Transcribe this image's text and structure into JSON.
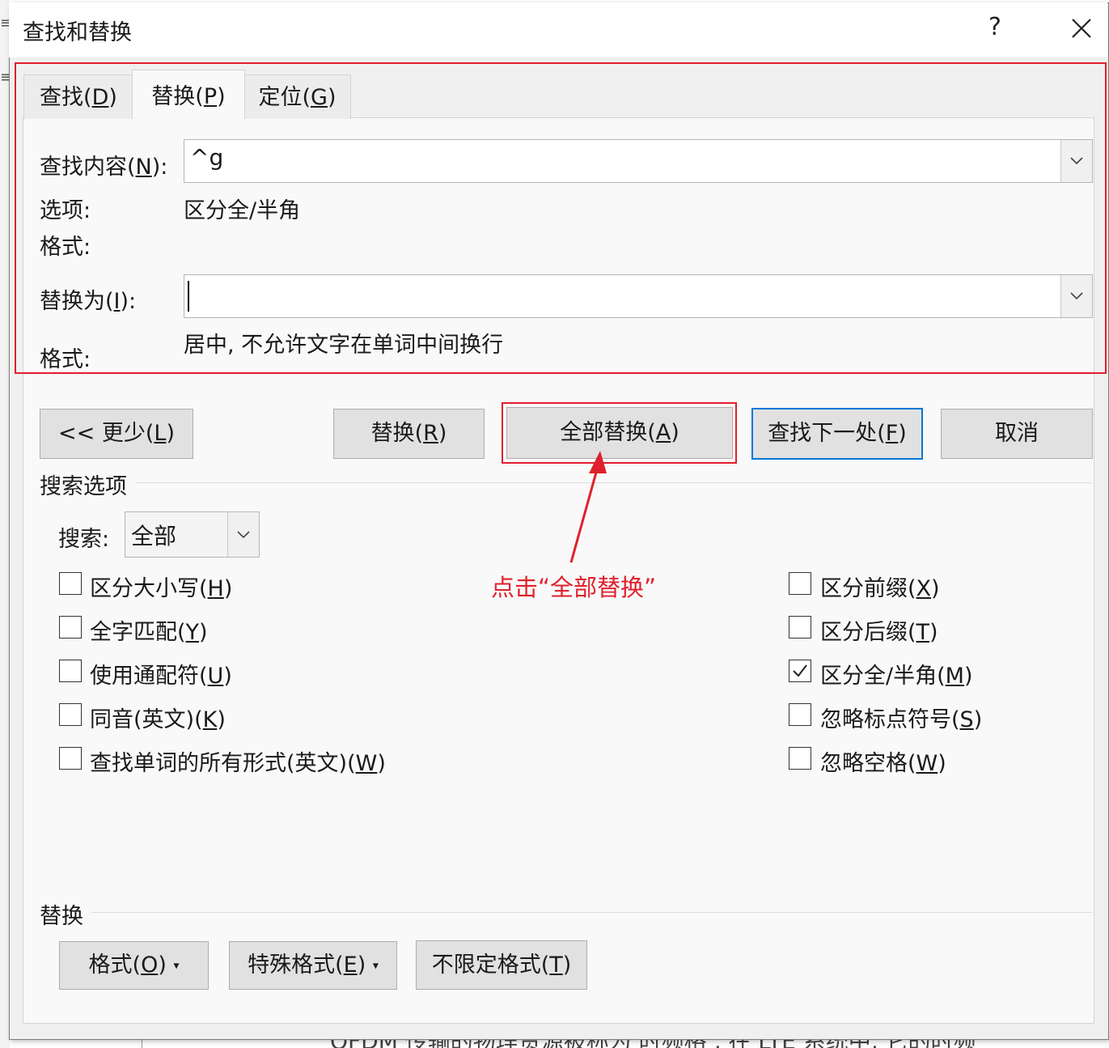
{
  "dialog": {
    "title": "查找和替换",
    "help": "?",
    "tabs": [
      {
        "label": "查找",
        "key": "D"
      },
      {
        "label": "替换",
        "key": "P"
      },
      {
        "label": "定位",
        "key": "G"
      }
    ],
    "find": {
      "label": "查找内容",
      "key": "N",
      "value": "^g"
    },
    "options_label": "选项:",
    "options_value": "区分全/半角",
    "format_label": "格式:",
    "replace": {
      "label": "替换为",
      "key": "I",
      "value": ""
    },
    "replace_format_label": "格式:",
    "replace_format_value": "居中, 不允许文字在单词中间换行",
    "buttons": {
      "less": {
        "prefix": "<< 更少",
        "key": "L"
      },
      "replace": {
        "prefix": "替换",
        "key": "R"
      },
      "replace_all": {
        "prefix": "全部替换",
        "key": "A"
      },
      "find_next": {
        "prefix": "查找下一处",
        "key": "F"
      },
      "cancel": "取消"
    },
    "search_options": {
      "title": "搜索选项",
      "search_label": "搜索:",
      "search_value": "全部",
      "left_checks": [
        {
          "label": "区分大小写",
          "key": "H",
          "checked": false
        },
        {
          "label": "全字匹配",
          "key": "Y",
          "checked": false
        },
        {
          "label": "使用通配符",
          "key": "U",
          "checked": false
        },
        {
          "label": "同音(英文)",
          "key": "K",
          "checked": false
        },
        {
          "label": "查找单词的所有形式(英文)",
          "key": "W",
          "checked": false
        }
      ],
      "right_checks": [
        {
          "label": "区分前缀",
          "key": "X",
          "checked": false
        },
        {
          "label": "区分后缀",
          "key": "T",
          "checked": false
        },
        {
          "label": "区分全/半角",
          "key": "M",
          "checked": true
        },
        {
          "label": "忽略标点符号",
          "key": "S",
          "checked": false
        },
        {
          "label": "忽略空格",
          "key": "W",
          "checked": false
        }
      ]
    },
    "replace_section": {
      "title": "替换",
      "format_btn": {
        "prefix": "格式",
        "key": "O"
      },
      "special_btn": {
        "prefix": "特殊格式",
        "key": "E"
      },
      "no_format_btn": {
        "prefix": "不限定格式",
        "key": "T"
      }
    }
  },
  "annotation": "点击“全部替换”",
  "background_text": "OFDM 传输的物理资源被称为 时频格 , 在 LTE 系统中, 它的时频",
  "colors": {
    "highlight": "#e0202c",
    "default_button": "#0078d7"
  }
}
